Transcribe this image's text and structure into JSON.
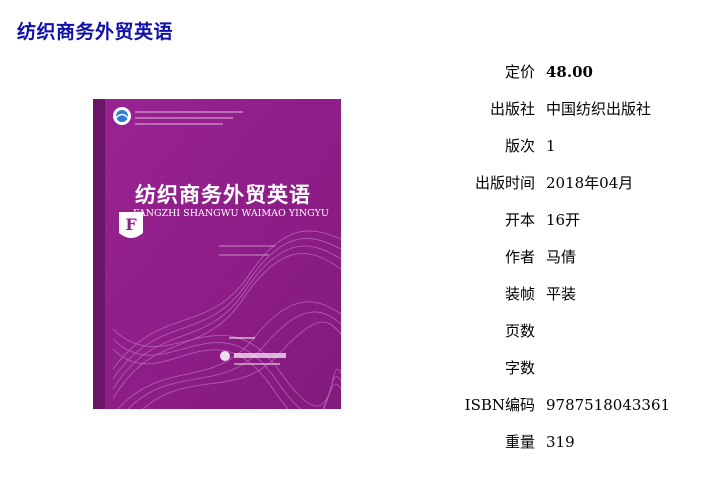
{
  "page_title": "纺织商务外贸英语",
  "cover": {
    "title": "纺织商务外贸英语",
    "pinyin": "FANGZHI SHANGWU WAIMAO YINGYU",
    "badge_letter": "F",
    "colors": {
      "background": "#8e1e88",
      "spine": "#6a1565",
      "badge": "#ffffff",
      "pattern": "#c678c0"
    }
  },
  "specs": [
    {
      "label": "定价",
      "value": "48.00"
    },
    {
      "label": "出版社",
      "value": "中国纺织出版社"
    },
    {
      "label": "版次",
      "value": "1"
    },
    {
      "label": "出版时间",
      "value": "2018年04月"
    },
    {
      "label": "开本",
      "value": "16开"
    },
    {
      "label": "作者",
      "value": "马倩"
    },
    {
      "label": "装帧",
      "value": "平装"
    },
    {
      "label": "页数",
      "value": ""
    },
    {
      "label": "字数",
      "value": ""
    },
    {
      "label": "ISBN编码",
      "value": "9787518043361"
    },
    {
      "label": "重量",
      "value": "319"
    }
  ]
}
